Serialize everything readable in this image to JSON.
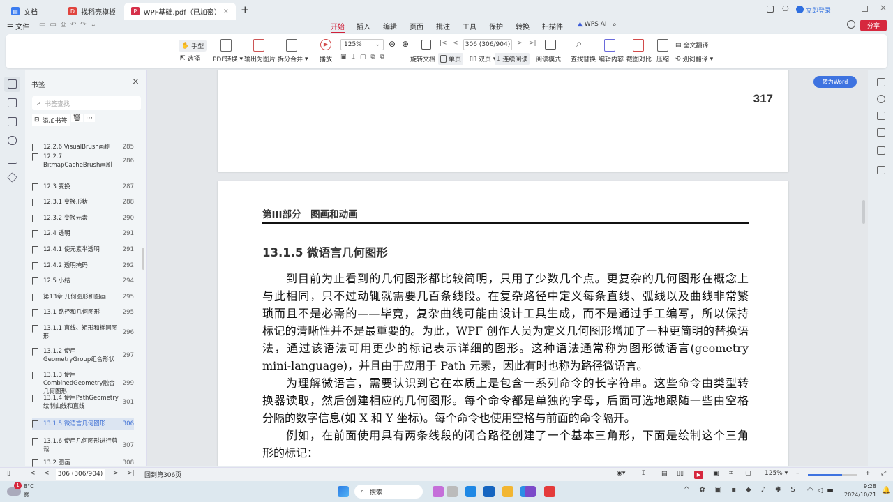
{
  "tabs": [
    {
      "label": "文档",
      "color": "#3b7cf0"
    },
    {
      "label": "找稻壳模板",
      "color": "#e0443e"
    },
    {
      "label": "WPF基础.pdf（已加密）",
      "color": "#d6304a"
    }
  ],
  "window": {
    "login": "立即登录",
    "share": "分享"
  },
  "menu": {
    "file": "文件",
    "items": [
      "开始",
      "插入",
      "编辑",
      "页面",
      "批注",
      "工具",
      "保护",
      "转换",
      "扫描件"
    ],
    "ai": "WPS AI"
  },
  "ribbon": {
    "hand": "手型",
    "select": "选择",
    "pdf_convert": "PDF转换",
    "export_image": "输出为图片",
    "split_merge": "拆分合并",
    "play": "播放",
    "zoom": "125%",
    "rotate": "旋转文档",
    "page_input": "306 (306/904)",
    "single": "单页",
    "double": "双页",
    "continuous": "连续阅读",
    "read_mode": "阅读模式",
    "find_replace": "查找替换",
    "edit_content": "编辑内容",
    "compare": "截图对比",
    "compress": "压缩",
    "full_translate": "全文翻译",
    "word_translate": "划词翻译"
  },
  "sidebar": {
    "title": "书签",
    "search_placeholder": "书签查找",
    "add_bookmark": "添加书签",
    "items": [
      {
        "label": "12.2.6 VisualBrush画刷",
        "page": "285"
      },
      {
        "label": "12.2.7 BitmapCacheBrush画刷",
        "page": "286"
      },
      {
        "label": "12.3 变换",
        "page": "287"
      },
      {
        "label": "12.3.1 变换形状",
        "page": "288"
      },
      {
        "label": "12.3.2 变换元素",
        "page": "290"
      },
      {
        "label": "12.4 透明",
        "page": "291"
      },
      {
        "label": "12.4.1 使元素半透明",
        "page": "291"
      },
      {
        "label": "12.4.2 透明掩码",
        "page": "292"
      },
      {
        "label": "12.5 小结",
        "page": "294"
      },
      {
        "label": "第13章 几何图形和图画",
        "page": "295"
      },
      {
        "label": "13.1 路径和几何图形",
        "page": "295"
      },
      {
        "label": "13.1.1 直线、矩形和椭圆图形",
        "page": "296"
      },
      {
        "label": "13.1.2 使用GeometryGroup组合形状",
        "page": "297"
      },
      {
        "label": "13.1.3 使用CombinedGeometry融合几何图形",
        "page": "299"
      },
      {
        "label": "13.1.4 使用PathGeometry绘制曲线和直线",
        "page": "301"
      },
      {
        "label": "13.1.5 微语言几何图形",
        "page": "306"
      },
      {
        "label": "13.1.6 使用几何图形进行剪裁",
        "page": "307"
      },
      {
        "label": "13.2 图画",
        "page": "308"
      }
    ]
  },
  "document": {
    "prev_page_number": "317",
    "part_header": "第III部分　图画和动画",
    "section_title": "13.1.5 微语言几何图形",
    "to_word": "转为Word",
    "paragraphs": [
      [
        "到目前为止看到的几何图形都比较简明，只用了少数几个点。更复杂的几何图形在概念上",
        "与此相同，只不过动辄就需要几百条线段。在复杂路径中定义每条直线、弧线以及曲线非常繁",
        "琐而且不是必需的——毕竟，复杂曲线可能由设计工具生成，而不是通过手工编写，所以保持",
        "标记的清晰性并不是最重要的。为此，WPF 创作人员为定义几何图形增加了一种更简明的替换语",
        "法，通过该语法可用更少的标记表示详细的图形。这种语法通常称为图形微语言(geometry",
        "mini-language)，并且由于应用于 Path 元素，因此有时也称为路径微语言。"
      ],
      [
        "为理解微语言，需要认识到它在本质上是包含一系列命令的长字符串。这些命令由类型转",
        "换器读取，然后创建相应的几何图形。每个命令都是单独的字母，后面可选地跟随一些由空格",
        "分隔的数字信息(如 X 和 Y 坐标)。每个命令也使用空格与前面的命令隔开。"
      ],
      [
        "例如，在前面使用具有两条线段的闭合路径创建了一个基本三角形，下面是绘制这个三角",
        "形的标记："
      ]
    ]
  },
  "status": {
    "page_input": "306 (306/904)",
    "back": "回到第306页",
    "zoom": "125%",
    "zoom_fraction": 0.7
  },
  "taskbar": {
    "weather_temp": "8°C",
    "weather_desc": "雾",
    "weather_badge": "1",
    "search": "搜索",
    "time": "9:28",
    "date": "2024/10/21"
  }
}
